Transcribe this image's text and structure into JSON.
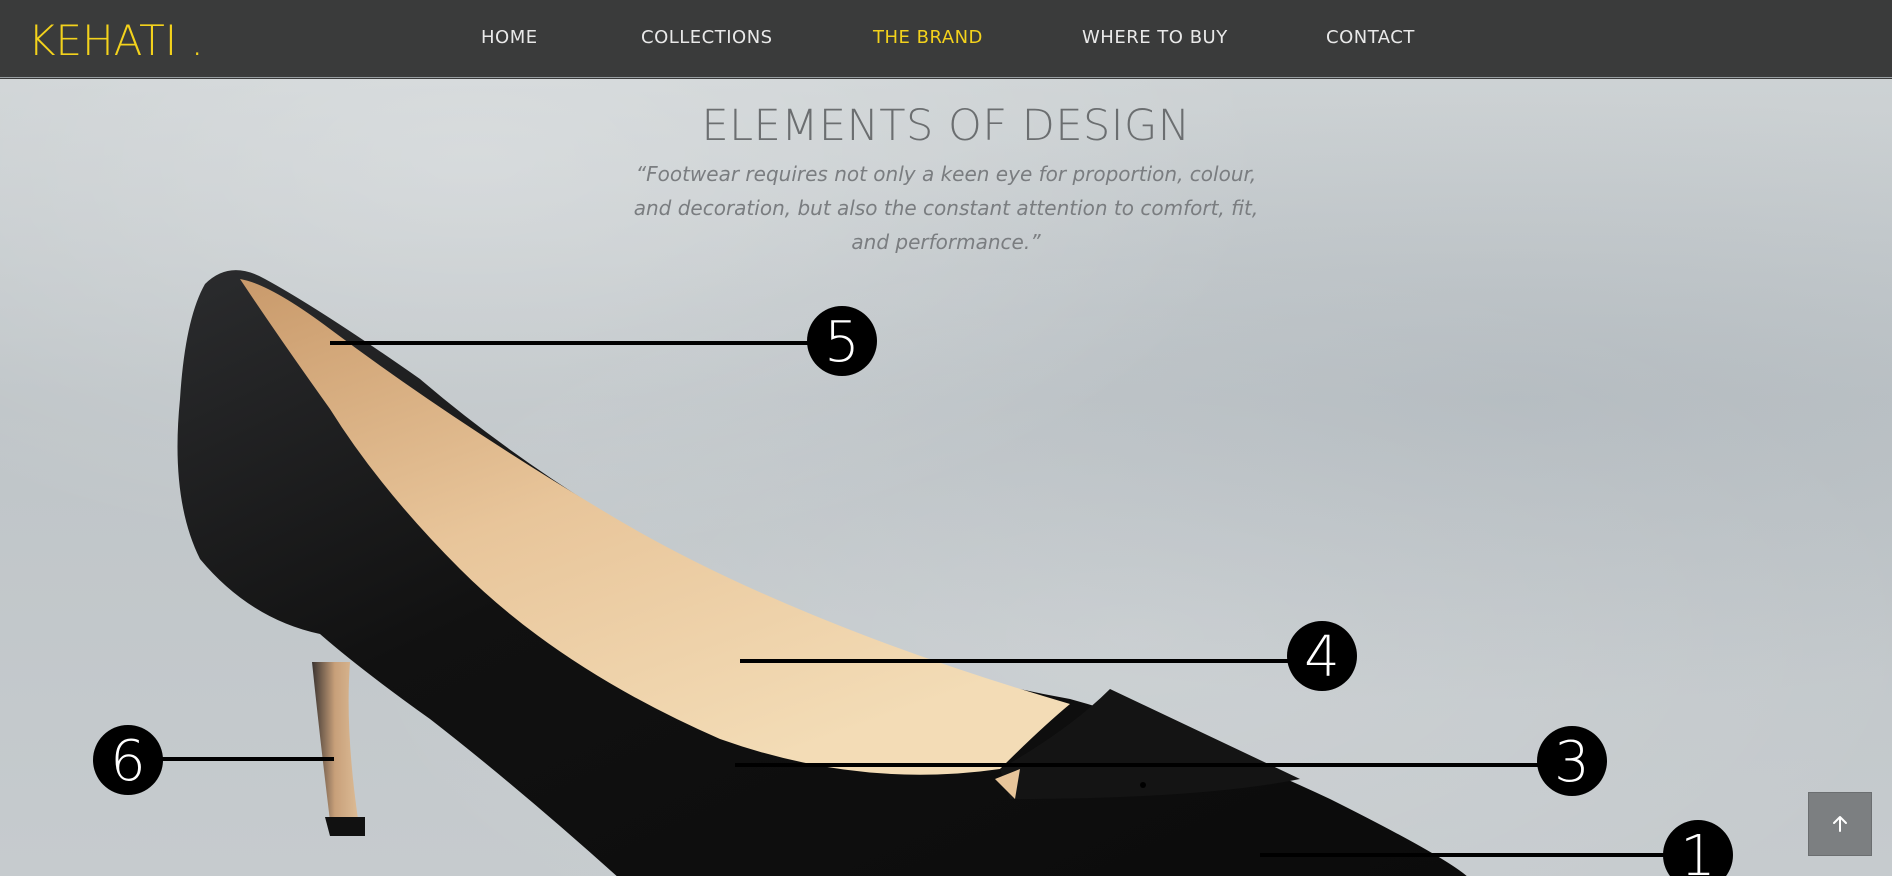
{
  "header": {
    "logo": "KEHATI .",
    "nav": [
      {
        "label": "HOME",
        "active": false
      },
      {
        "label": "COLLECTIONS",
        "active": false
      },
      {
        "label": "THE BRAND",
        "active": true
      },
      {
        "label": "WHERE TO BUY",
        "active": false
      },
      {
        "label": "CONTACT",
        "active": false
      }
    ]
  },
  "hero": {
    "title": "ELEMENTS OF DESIGN",
    "quote": "“Footwear requires not only a keen eye for proportion, colour, and decoration, but also the constant attention to comfort, fit, and performance.”",
    "markers": [
      "5",
      "4",
      "3",
      "6",
      "1"
    ]
  },
  "colors": {
    "accent": "#f3d21c",
    "header_bg": "#3a3b3b"
  },
  "icons": {
    "scroll_top": "arrow-up-icon"
  }
}
